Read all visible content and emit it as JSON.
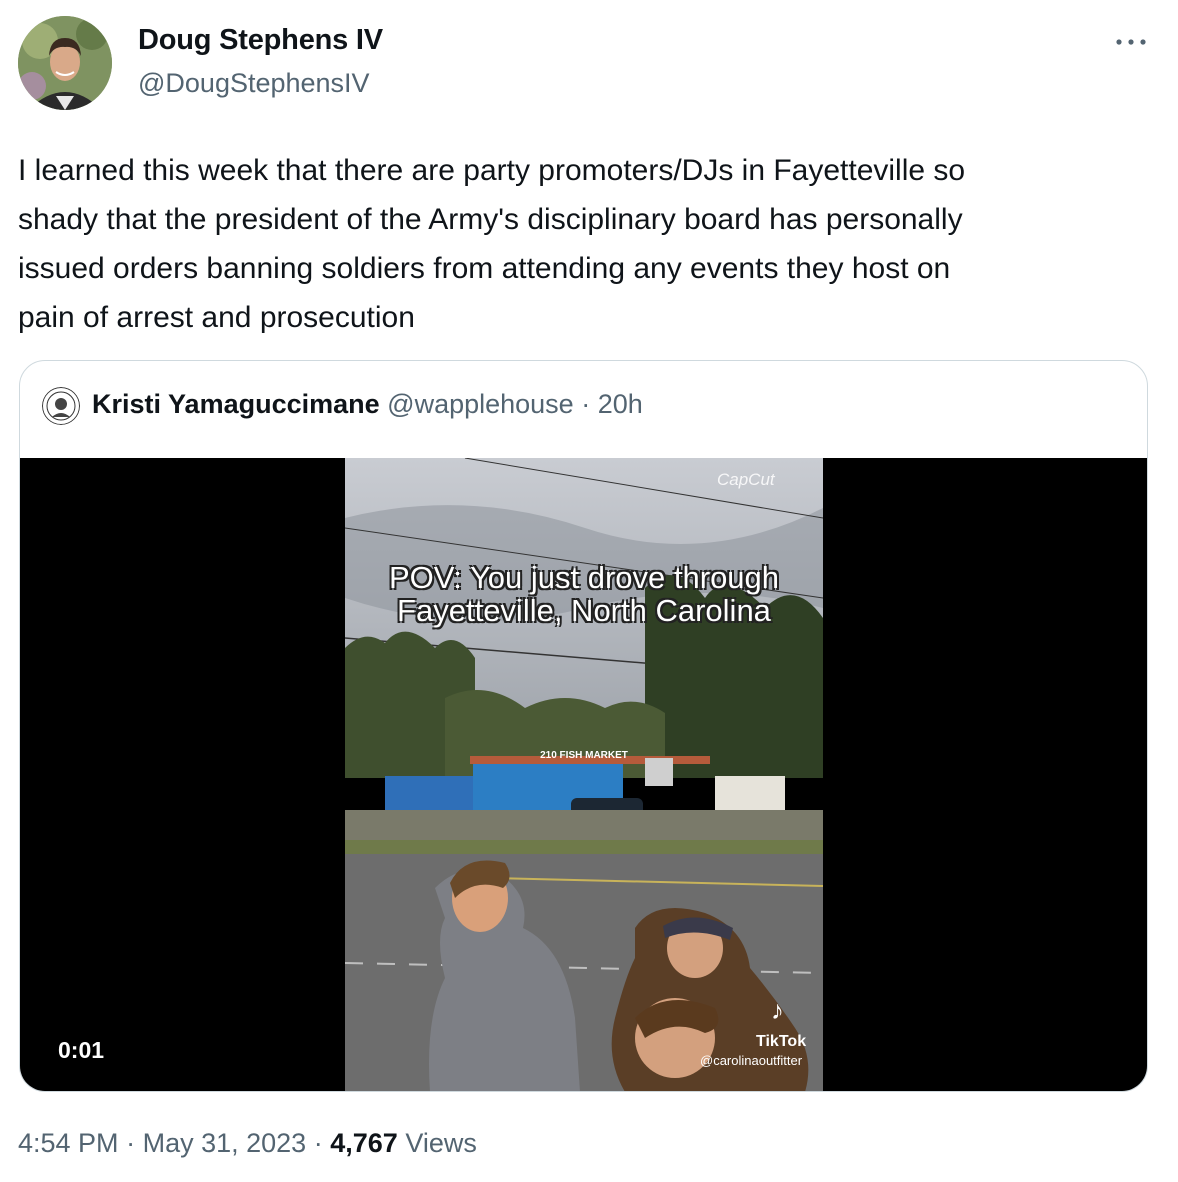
{
  "author": {
    "name": "Doug Stephens IV",
    "handle": "@DougStephensIV"
  },
  "tweet": {
    "text": "I learned this week that there are party promoters/DJs in Fayetteville so\nshady that the president of the Army's disciplinary board has personally\nissued orders banning soldiers from attending any events they host on\npain of arrest and prosecution"
  },
  "quote": {
    "name": "Kristi Yamaguccimane",
    "handle": "@wapplehouse",
    "separator": "·",
    "time": "20h",
    "video": {
      "caption_line1": "POV: You just drove through",
      "caption_line2": "Fayetteville, North Carolina",
      "capcut_label": "CapCut",
      "sign_text": "210 FISH MARKET",
      "tiktok_label": "TikTok",
      "tiktok_user": "@carolinaoutfitter",
      "duration": "0:01"
    }
  },
  "meta": {
    "time": "4:54 PM",
    "separator": "·",
    "date": "May 31, 2023",
    "views_count": "4,767",
    "views_label": "Views"
  },
  "icons": {
    "more": "more-horizontal-icon",
    "tiktok": "tiktok-icon"
  },
  "colors": {
    "secondary_text": "#536471",
    "primary_text": "#0f1419",
    "border": "#cfd9de",
    "video_background": "#000000"
  }
}
